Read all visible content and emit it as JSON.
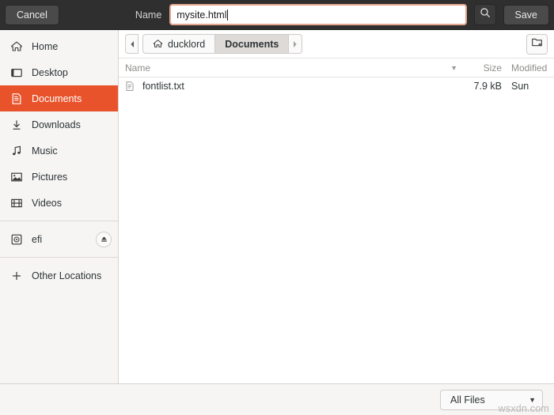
{
  "header": {
    "cancel_label": "Cancel",
    "name_label": "Name",
    "filename_value": "mysite.html",
    "search_icon": "search-icon",
    "save_label": "Save"
  },
  "sidebar": {
    "items": [
      {
        "label": "Home",
        "icon": "home-icon",
        "active": false
      },
      {
        "label": "Desktop",
        "icon": "desktop-icon",
        "active": false
      },
      {
        "label": "Documents",
        "icon": "document-icon",
        "active": true
      },
      {
        "label": "Downloads",
        "icon": "download-icon",
        "active": false
      },
      {
        "label": "Music",
        "icon": "music-note-icon",
        "active": false
      },
      {
        "label": "Pictures",
        "icon": "image-icon",
        "active": false
      },
      {
        "label": "Videos",
        "icon": "film-icon",
        "active": false
      },
      {
        "label": "efi",
        "icon": "disk-icon",
        "active": false
      },
      {
        "label": "Other Locations",
        "icon": "plus-icon",
        "active": false
      }
    ],
    "eject_icon": "eject-icon"
  },
  "pathbar": {
    "back_icon": "chevron-left-icon",
    "forward_icon": "chevron-right-icon",
    "crumbs": [
      {
        "label": "ducklord",
        "icon": "home-icon",
        "current": false
      },
      {
        "label": "Documents",
        "icon": "",
        "current": true
      }
    ],
    "new_folder_icon": "new-folder-icon"
  },
  "columns": {
    "name": "Name",
    "size": "Size",
    "modified": "Modified",
    "sort_arrow": "▼"
  },
  "files": [
    {
      "name": "fontlist.txt",
      "size": "7.9 kB",
      "modified": "Sun",
      "icon": "text-file-icon"
    }
  ],
  "footer": {
    "filter_label": "All Files",
    "filter_arrow": "▼",
    "watermark": "wsxdn.com"
  },
  "colors": {
    "accent": "#e8532b",
    "headerbar": "#2f2f2f",
    "sidebar_bg": "#f6f5f4",
    "entry_focus_border": "#e4a68e"
  }
}
